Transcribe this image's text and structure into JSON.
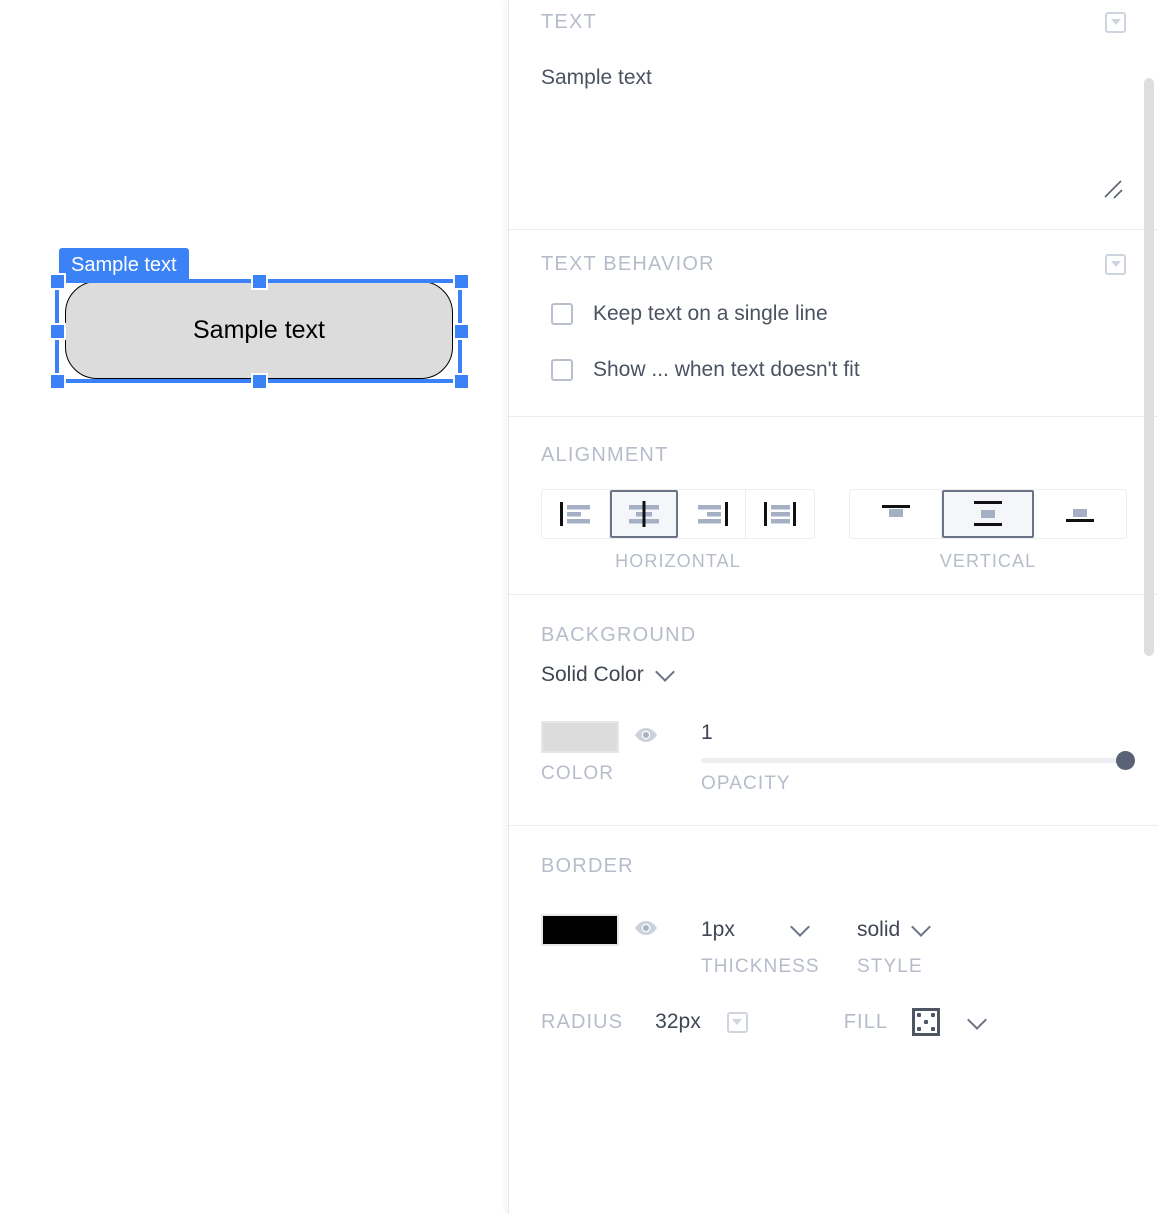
{
  "canvas": {
    "shape": {
      "name_tag": "Sample text",
      "inner_text": "Sample text",
      "fill_color": "#dcdcdc",
      "border_color": "#000000",
      "border_radius": "32px",
      "selection_color": "#3b82f6"
    }
  },
  "panel": {
    "sections": {
      "text": {
        "title": "TEXT",
        "value": "Sample text",
        "collapse_icon": "chevron-down-icon",
        "resize_icon": "resize-handle-icon"
      },
      "text_behavior": {
        "title": "TEXT BEHAVIOR",
        "collapse_icon": "chevron-down-icon",
        "options": [
          {
            "label": "Keep text on a single line",
            "checked": false
          },
          {
            "label": "Show ... when text doesn't fit",
            "checked": false
          }
        ]
      },
      "alignment": {
        "title": "ALIGNMENT",
        "horizontal": {
          "caption": "HORIZONTAL",
          "selected_index": 1,
          "buttons": [
            {
              "name": "align-left-icon",
              "label": "left"
            },
            {
              "name": "align-center-icon",
              "label": "center"
            },
            {
              "name": "align-right-icon",
              "label": "right"
            },
            {
              "name": "align-justify-icon",
              "label": "justify"
            }
          ]
        },
        "vertical": {
          "caption": "VERTICAL",
          "selected_index": 1,
          "buttons": [
            {
              "name": "align-top-icon",
              "label": "top"
            },
            {
              "name": "align-middle-icon",
              "label": "middle"
            },
            {
              "name": "align-bottom-icon",
              "label": "bottom"
            }
          ]
        }
      },
      "background": {
        "title": "BACKGROUND",
        "type_value": "Solid Color",
        "color": {
          "caption": "COLOR",
          "value": "#dcdcdc",
          "visibility_icon": "eye-icon"
        },
        "opacity": {
          "caption": "OPACITY",
          "value": "1",
          "percent": 100
        }
      },
      "border": {
        "title": "BORDER",
        "color": {
          "value": "#000000",
          "visibility_icon": "eye-icon"
        },
        "thickness": {
          "caption": "THICKNESS",
          "value": "1px"
        },
        "style": {
          "caption": "STYLE",
          "value": "solid"
        },
        "radius": {
          "label": "RADIUS",
          "value": "32px",
          "picker_icon": "chevron-down-icon"
        },
        "fill": {
          "label": "FILL",
          "icon": "fill-pattern-icon",
          "chevron_icon": "chevron-down-icon"
        }
      }
    },
    "scrollbar": {
      "name": "panel-scrollbar"
    }
  }
}
